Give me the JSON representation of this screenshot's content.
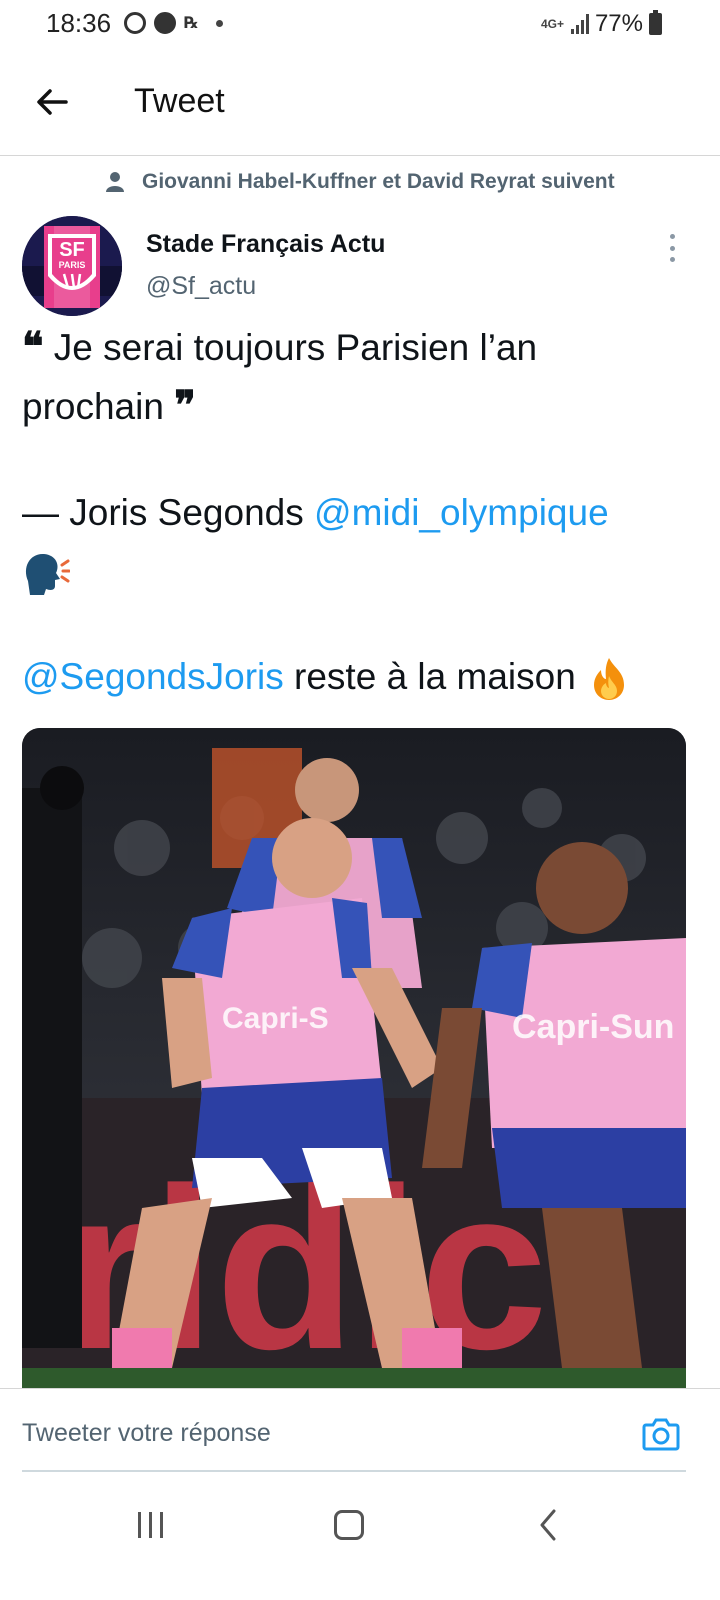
{
  "status_bar": {
    "time": "18:36",
    "network": "4G+",
    "battery": "77%",
    "icons": [
      "message-icon",
      "notification-icon",
      "app-icon",
      "dot-icon",
      "signal-icon",
      "battery-icon"
    ]
  },
  "header": {
    "title": "Tweet",
    "back_icon": "back-arrow-icon"
  },
  "social_context": {
    "text": "Giovanni Habel-Kuffner et David Reyrat suivent",
    "icon": "person-icon"
  },
  "tweet": {
    "author_name": "Stade Français Actu",
    "author_handle": "@Sf_actu",
    "avatar_text_top": "SF",
    "avatar_text_bottom": "PARIS",
    "open_quote": "❝",
    "line1": " Je serai toujours Parisien l’an",
    "line2": "prochain ",
    "close_quote": "❞",
    "attribution_prefix": "— Joris Segonds ",
    "mention1": "@midi_olympique",
    "mention2": "@SegondsJoris",
    "closing_text": " reste à la maison ",
    "emojis": [
      "speaking-head-icon",
      "fire-icon"
    ]
  },
  "reply": {
    "placeholder": "Tweeter votre réponse",
    "camera_icon": "camera-icon"
  },
  "colors": {
    "link": "#1d9bf0",
    "secondary_text": "#536471",
    "primary_text": "#0f1419",
    "divider": "#d6d6d6"
  },
  "nav_bar": {
    "icons": [
      "recent-apps-icon",
      "home-icon",
      "back-icon"
    ]
  }
}
